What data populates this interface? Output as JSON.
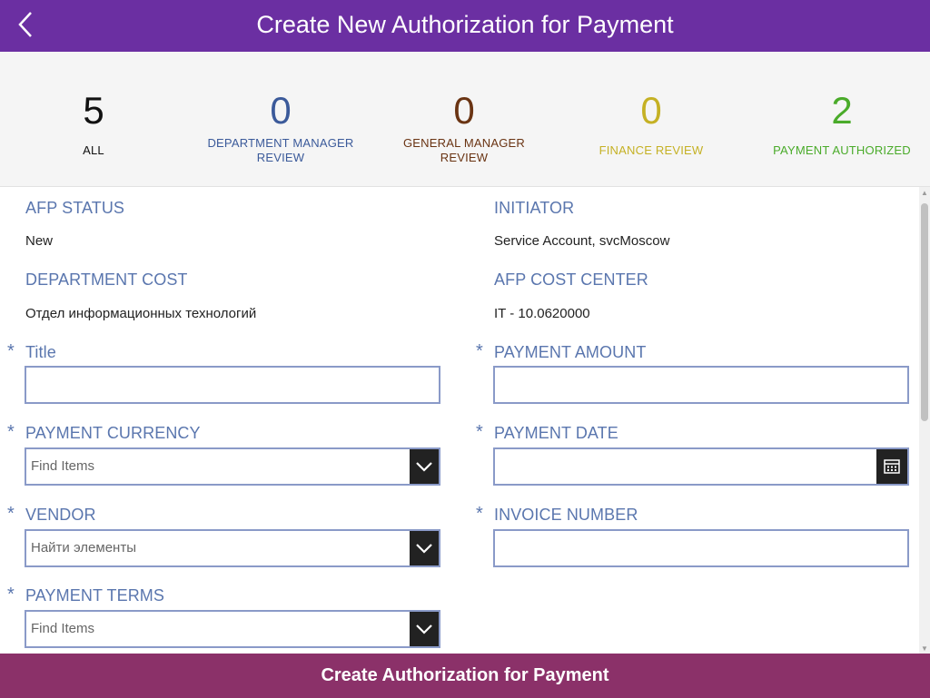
{
  "header": {
    "title": "Create New Authorization for Payment",
    "back_icon": "chevron-left-icon"
  },
  "stats": [
    {
      "value": "5",
      "label": "ALL",
      "color": "#111111"
    },
    {
      "value": "0",
      "label": "DEPARTMENT MANAGER REVIEW",
      "color": "#3b5a9a"
    },
    {
      "value": "0",
      "label": "GENERAL MANAGER REVIEW",
      "color": "#6a3413"
    },
    {
      "value": "0",
      "label": "FINANCE REVIEW",
      "color": "#c5b124"
    },
    {
      "value": "2",
      "label": "PAYMENT AUTHORIZED",
      "color": "#4aab2a"
    }
  ],
  "info": {
    "afp_status": {
      "label": "AFP STATUS",
      "value": "New"
    },
    "initiator": {
      "label": "INITIATOR",
      "value": "Service Account, svcMoscow"
    },
    "department_cost": {
      "label": "DEPARTMENT COST",
      "value": "Отдел информационных технологий"
    },
    "afp_cost_center": {
      "label": "AFP COST CENTER",
      "value": "IT - 10.0620000"
    }
  },
  "fields": {
    "required_marker": "*",
    "title": {
      "label": "Title",
      "value": ""
    },
    "payment_amount": {
      "label": "PAYMENT AMOUNT",
      "value": ""
    },
    "payment_currency": {
      "label": "PAYMENT CURRENCY",
      "placeholder": "Find Items"
    },
    "payment_date": {
      "label": "PAYMENT DATE",
      "value": ""
    },
    "vendor": {
      "label": "VENDOR",
      "placeholder": "Найти элементы"
    },
    "invoice_number": {
      "label": "INVOICE NUMBER",
      "value": ""
    },
    "payment_terms": {
      "label": "PAYMENT TERMS",
      "placeholder": "Find Items"
    }
  },
  "footer": {
    "button_label": "Create Authorization for Payment"
  },
  "colors": {
    "header_bg": "#6b2fa2",
    "footer_bg": "#8b3169",
    "label_color": "#5a76ae",
    "input_border": "#8a9ac8"
  }
}
